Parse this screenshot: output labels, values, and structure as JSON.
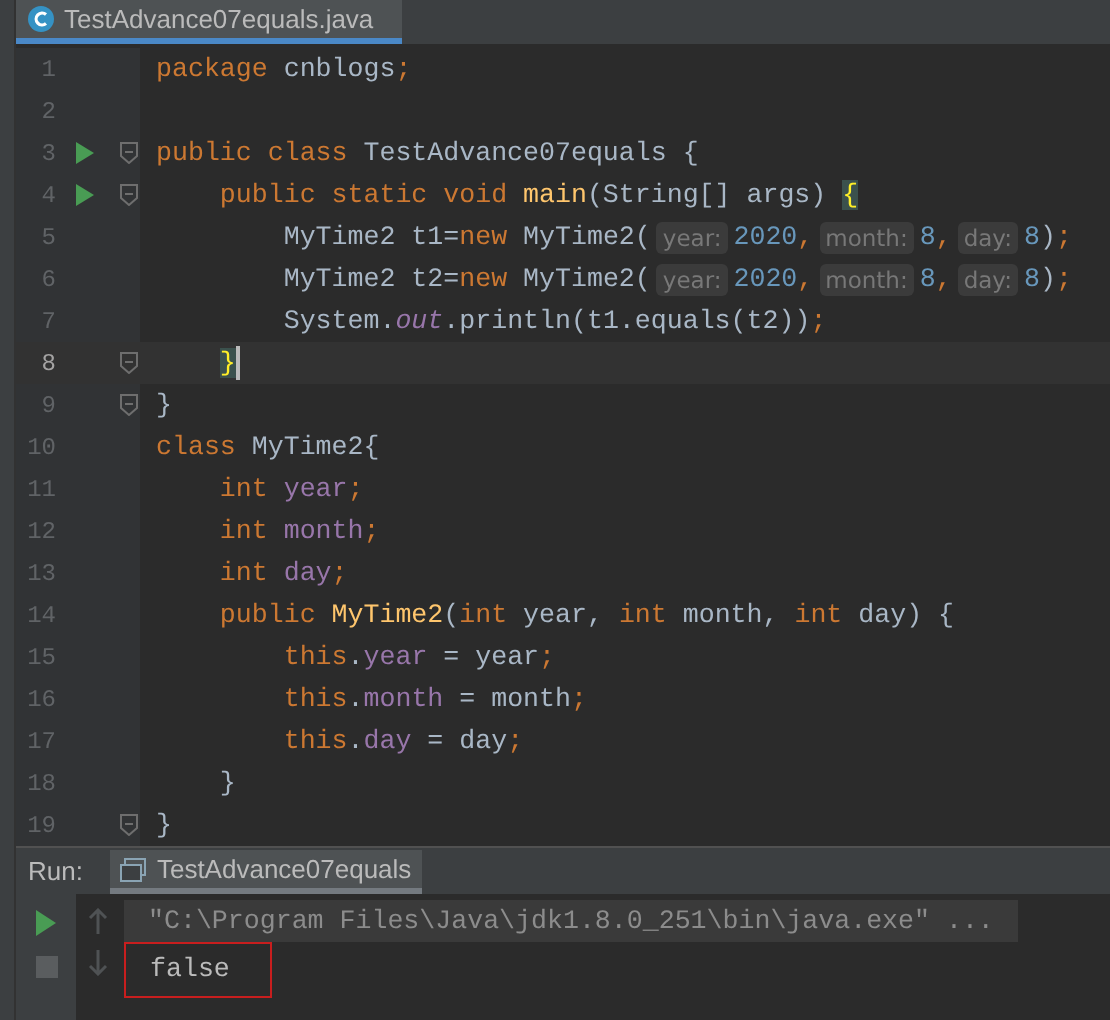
{
  "editor_tab": {
    "title": "TestAdvance07equals.java",
    "selected": true
  },
  "lines": [
    {
      "number": "1",
      "tokens": [
        {
          "text": "package",
          "kind": "kw"
        },
        {
          "text": " cnblogs",
          "kind": "plain"
        },
        {
          "text": ";",
          "kind": "kw"
        }
      ]
    },
    {
      "number": "2"
    },
    {
      "number": "3",
      "run": true,
      "fold": true,
      "tokens": [
        {
          "text": "public class ",
          "kind": "kw"
        },
        {
          "text": "TestAdvance07equals {",
          "kind": "plain"
        }
      ]
    },
    {
      "number": "4",
      "run": true,
      "fold": true,
      "tokens": [
        {
          "text": "    public static void ",
          "kind": "kw"
        },
        {
          "text": "main",
          "kind": "method"
        },
        {
          "text": "(String[] args) ",
          "kind": "plain"
        },
        {
          "text": "{",
          "kind": "brace"
        }
      ]
    },
    {
      "number": "5",
      "tokens": [
        {
          "text": "        MyTime2 t1=",
          "kind": "plain"
        },
        {
          "text": "new",
          "kind": "kw"
        },
        {
          "text": " MyTime2(",
          "kind": "plain"
        },
        {
          "text": "year:",
          "kind": "hint"
        },
        {
          "text": "2020",
          "kind": "num"
        },
        {
          "text": ",",
          "kind": "kw"
        },
        {
          "text": "month:",
          "kind": "hint"
        },
        {
          "text": "8",
          "kind": "num"
        },
        {
          "text": ",",
          "kind": "kw"
        },
        {
          "text": "day:",
          "kind": "hint"
        },
        {
          "text": "8",
          "kind": "num"
        },
        {
          "text": ")",
          "kind": "plain"
        },
        {
          "text": ";",
          "kind": "kw"
        }
      ]
    },
    {
      "number": "6",
      "tokens": [
        {
          "text": "        MyTime2 t2=",
          "kind": "plain"
        },
        {
          "text": "new",
          "kind": "kw"
        },
        {
          "text": " MyTime2(",
          "kind": "plain"
        },
        {
          "text": "year:",
          "kind": "hint"
        },
        {
          "text": "2020",
          "kind": "num"
        },
        {
          "text": ",",
          "kind": "kw"
        },
        {
          "text": "month:",
          "kind": "hint"
        },
        {
          "text": "8",
          "kind": "num"
        },
        {
          "text": ",",
          "kind": "kw"
        },
        {
          "text": "day:",
          "kind": "hint"
        },
        {
          "text": "8",
          "kind": "num"
        },
        {
          "text": ")",
          "kind": "plain"
        },
        {
          "text": ";",
          "kind": "kw"
        }
      ]
    },
    {
      "number": "7",
      "tokens": [
        {
          "text": "        System.",
          "kind": "plain"
        },
        {
          "text": "out",
          "kind": "static"
        },
        {
          "text": ".println(t1.equals(t2))",
          "kind": "plain"
        },
        {
          "text": ";",
          "kind": "kw"
        }
      ]
    },
    {
      "number": "8",
      "fold": true,
      "current": true,
      "caret": true,
      "tokens": [
        {
          "text": "    }",
          "kind": "brace"
        }
      ]
    },
    {
      "number": "9",
      "fold": true,
      "tokens": [
        {
          "text": "}",
          "kind": "plain"
        }
      ]
    },
    {
      "number": "10",
      "tokens": [
        {
          "text": "class ",
          "kind": "kw"
        },
        {
          "text": "MyTime2{",
          "kind": "plain"
        }
      ]
    },
    {
      "number": "11",
      "tokens": [
        {
          "text": "    int ",
          "kind": "kw"
        },
        {
          "text": "year",
          "kind": "field"
        },
        {
          "text": ";",
          "kind": "kw"
        }
      ]
    },
    {
      "number": "12",
      "tokens": [
        {
          "text": "    int ",
          "kind": "kw"
        },
        {
          "text": "month",
          "kind": "field"
        },
        {
          "text": ";",
          "kind": "kw"
        }
      ]
    },
    {
      "number": "13",
      "tokens": [
        {
          "text": "    int ",
          "kind": "kw"
        },
        {
          "text": "day",
          "kind": "field"
        },
        {
          "text": ";",
          "kind": "kw"
        }
      ]
    },
    {
      "number": "14",
      "tokens": [
        {
          "text": "    public ",
          "kind": "kw"
        },
        {
          "text": "MyTime2",
          "kind": "method"
        },
        {
          "text": "(",
          "kind": "plain"
        },
        {
          "text": "int ",
          "kind": "kw"
        },
        {
          "text": "year, ",
          "kind": "plain"
        },
        {
          "text": "int ",
          "kind": "kw"
        },
        {
          "text": "month, ",
          "kind": "plain"
        },
        {
          "text": "int ",
          "kind": "kw"
        },
        {
          "text": "day) {",
          "kind": "plain"
        }
      ]
    },
    {
      "number": "15",
      "tokens": [
        {
          "text": "        this",
          "kind": "kw"
        },
        {
          "text": ".",
          "kind": "plain"
        },
        {
          "text": "year",
          "kind": "field"
        },
        {
          "text": " = year",
          "kind": "plain"
        },
        {
          "text": ";",
          "kind": "kw"
        }
      ]
    },
    {
      "number": "16",
      "tokens": [
        {
          "text": "        this",
          "kind": "kw"
        },
        {
          "text": ".",
          "kind": "plain"
        },
        {
          "text": "month",
          "kind": "field"
        },
        {
          "text": " = month",
          "kind": "plain"
        },
        {
          "text": ";",
          "kind": "kw"
        }
      ]
    },
    {
      "number": "17",
      "tokens": [
        {
          "text": "        this",
          "kind": "kw"
        },
        {
          "text": ".",
          "kind": "plain"
        },
        {
          "text": "day",
          "kind": "field"
        },
        {
          "text": " = day",
          "kind": "plain"
        },
        {
          "text": ";",
          "kind": "kw"
        }
      ]
    },
    {
      "number": "18",
      "tokens": [
        {
          "text": "    }",
          "kind": "plain"
        }
      ]
    },
    {
      "number": "19",
      "fold": true,
      "tokens": [
        {
          "text": "}",
          "kind": "plain"
        }
      ]
    }
  ],
  "run_panel": {
    "label": "Run:",
    "tab": {
      "title": "TestAdvance07equals",
      "selected": true
    },
    "output": [
      {
        "text": "\"C:\\Program Files\\Java\\jdk1.8.0_251\\bin\\java.exe\" ...",
        "kind": "command"
      },
      {
        "text": "false",
        "kind": "result",
        "boxed": true
      }
    ]
  }
}
